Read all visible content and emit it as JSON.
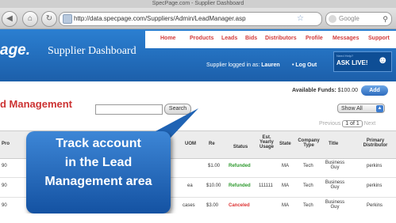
{
  "browser": {
    "window_title": "SpecPage.com - Supplier Dashboard",
    "url": "http://data.specpage.com/Suppliers/Admin/LeadManager.asp",
    "search_placeholder": "Google"
  },
  "header": {
    "logo": "age.",
    "title": "Supplier Dashboard",
    "nav": [
      "Home",
      "Products",
      "Leads",
      "Bids",
      "Distributors",
      "Profile",
      "Messages",
      "Support"
    ],
    "logged_in_text": "Supplier logged in as:",
    "logged_in_user": "Lauren",
    "logout": "• Log Out",
    "ask_live": "ASK LIVE!",
    "ask_small": "Need Help?"
  },
  "content": {
    "section_title": "d Management",
    "funds_label": "Available Funds:",
    "funds_value": "$100.00",
    "add_button": "Add",
    "search_button": "Search",
    "filter_value": "Show All",
    "pager_prev": "Previous",
    "pager_value": "1 of 1",
    "pager_next": "Next"
  },
  "table": {
    "headers": [
      "Pro",
      "UOM",
      "Re",
      "Status",
      "Est. Yearly Usage",
      "State",
      "Company Type",
      "Title",
      "Primary Distributor"
    ],
    "rows": [
      {
        "pro": "90",
        "uom": "",
        "price": "$1.00",
        "status": "Refunded",
        "usage": "",
        "state": "MA",
        "type": "Tech",
        "title": "Business Guy",
        "dist": "perkins"
      },
      {
        "pro": "90",
        "uom": "ea",
        "price": "$10.00",
        "status": "Refunded",
        "usage": "111111",
        "state": "MA",
        "type": "Tech",
        "title": "Business Guy",
        "dist": "perkins"
      },
      {
        "pro": "90",
        "uom": "cases",
        "price": "$3.00",
        "status": "Canceled",
        "usage": "",
        "state": "MA",
        "type": "Tech",
        "title": "Business Guy",
        "dist": "Perkins"
      }
    ]
  },
  "callout": {
    "line1": "Track account",
    "line2": "in the Lead",
    "line3": "Management area"
  },
  "colors": {
    "header_blue": "#1c5faa",
    "accent_red": "#d23b3b",
    "callout_blue": "#1452a2"
  }
}
